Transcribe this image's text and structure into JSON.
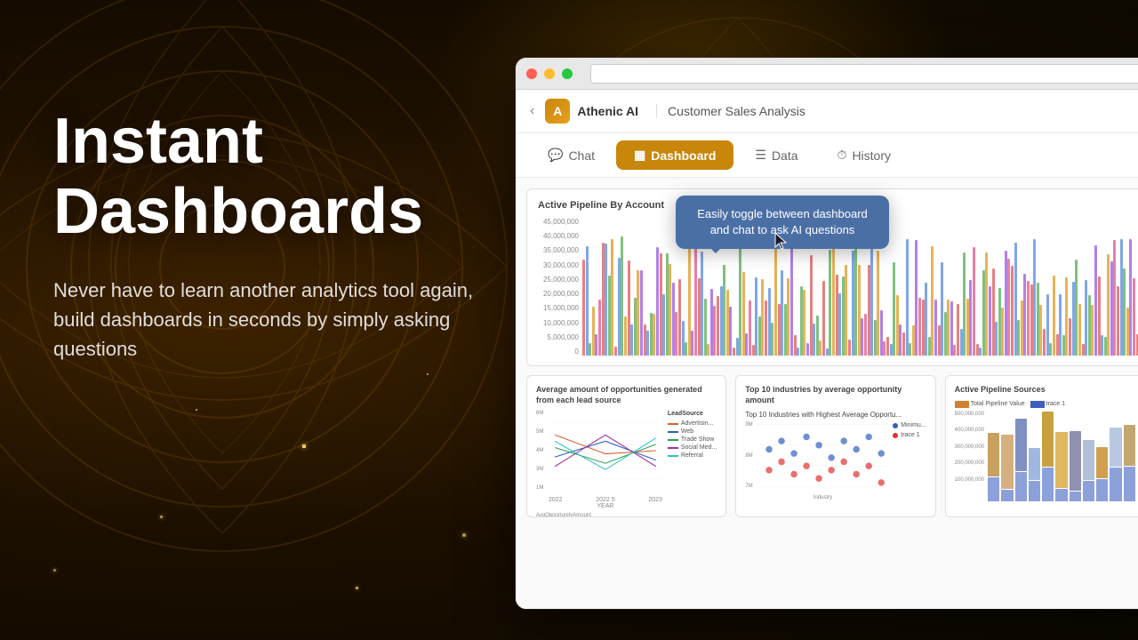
{
  "background": {
    "color": "#1a0e00"
  },
  "left_panel": {
    "main_title": "Instant\nDashboards",
    "sub_text": "Never have to learn another analytics tool again, build dashboards in seconds by simply asking questions"
  },
  "browser": {
    "title_bar": {
      "btn_red": "close",
      "btn_yellow": "minimize",
      "btn_green": "maximize"
    },
    "app_header": {
      "back_label": "‹",
      "logo_text": "Athenic AI",
      "page_title": "Customer Sales Analysis"
    },
    "tabs": [
      {
        "id": "chat",
        "label": "Chat",
        "icon": "💬",
        "active": false
      },
      {
        "id": "dashboard",
        "label": "Dashboard",
        "icon": "▦",
        "active": true
      },
      {
        "id": "data",
        "label": "Data",
        "icon": "☰",
        "active": false
      },
      {
        "id": "history",
        "label": "History",
        "icon": "⏱",
        "active": false
      }
    ],
    "tooltip": {
      "text": "Easily toggle between dashboard and chat to ask AI questions"
    },
    "charts": {
      "main_chart": {
        "title": "Active Pipeline By Account"
      },
      "bottom_left": {
        "title": "Average amount of opportunities generated from each lead source",
        "x_label": "YEAR",
        "y_label": "AvgOpportunityAmount",
        "lines": [
          {
            "label": "LeadSource",
            "color": "#888"
          },
          {
            "label": "Advertisin...",
            "color": "#e06030"
          },
          {
            "label": "Web",
            "color": "#3060c0"
          },
          {
            "label": "Trade Show",
            "color": "#30a060"
          },
          {
            "label": "Social Med...",
            "color": "#a030a0"
          },
          {
            "label": "Referral",
            "color": "#30c0c0"
          }
        ],
        "years": [
          "2022",
          "2022.5",
          "2023"
        ]
      },
      "bottom_middle": {
        "title": "Top 10 industries by average opportunity amount",
        "subtitle": "Top 10 Industries with Highest Average Opportu...",
        "legend_labels": [
          "Minimu...",
          "trace 1"
        ],
        "y_axis": [
          "9M",
          "8M",
          "7M"
        ],
        "x_label": "Industry"
      },
      "bottom_right": {
        "title": "Active Pipeline Sources",
        "legend_labels": [
          "Total Pipeline Value",
          "trace 1"
        ],
        "y_values": [
          "500,000,000",
          "400,000,000",
          "300,000,000",
          "200,000,000",
          "100,000,000"
        ]
      }
    }
  }
}
